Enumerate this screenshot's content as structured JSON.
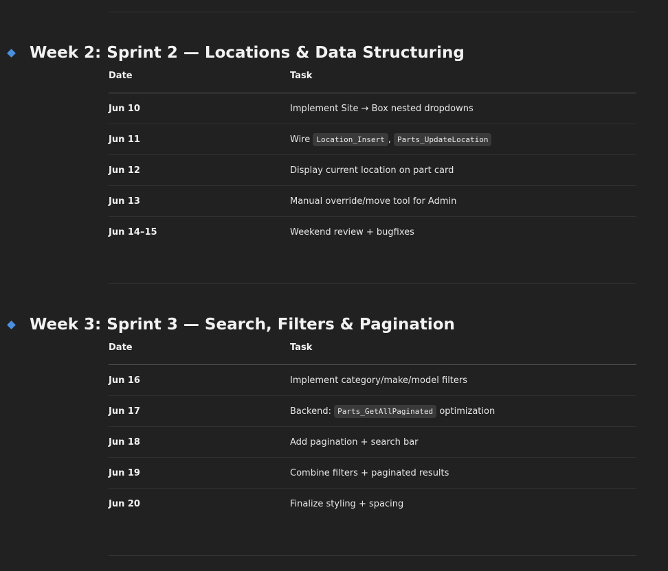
{
  "sections": [
    {
      "title": "Week 2: Sprint 2 — Locations & Data Structuring",
      "headers": {
        "date": "Date",
        "task": "Task"
      },
      "rows": [
        {
          "date": "Jun 10",
          "task": "Implement Site → Box nested dropdowns"
        },
        {
          "date": "Jun 11",
          "task_prefix": "Wire ",
          "code1": "Location_Insert",
          "sep": ", ",
          "code2": "Parts_UpdateLocation"
        },
        {
          "date": "Jun 12",
          "task": "Display current location on part card"
        },
        {
          "date": "Jun 13",
          "task": "Manual override/move tool for Admin"
        },
        {
          "date": "Jun 14–15",
          "task": "Weekend review + bugfixes"
        }
      ]
    },
    {
      "title": "Week 3: Sprint 3 — Search, Filters & Pagination",
      "headers": {
        "date": "Date",
        "task": "Task"
      },
      "rows": [
        {
          "date": "Jun 16",
          "task": "Implement category/make/model filters"
        },
        {
          "date": "Jun 17",
          "task_prefix": "Backend: ",
          "code1": "Parts_GetAllPaginated",
          "task_suffix": " optimization"
        },
        {
          "date": "Jun 18",
          "task": "Add pagination + search bar"
        },
        {
          "date": "Jun 19",
          "task": "Combine filters + paginated results"
        },
        {
          "date": "Jun 20",
          "task": "Finalize styling + spacing"
        }
      ]
    }
  ],
  "colors": {
    "background": "#212121",
    "accent_diamond": "#4a8fe0",
    "code_background": "#3a3a3a"
  },
  "icons": {
    "section_bullet": "blue-diamond-icon"
  }
}
